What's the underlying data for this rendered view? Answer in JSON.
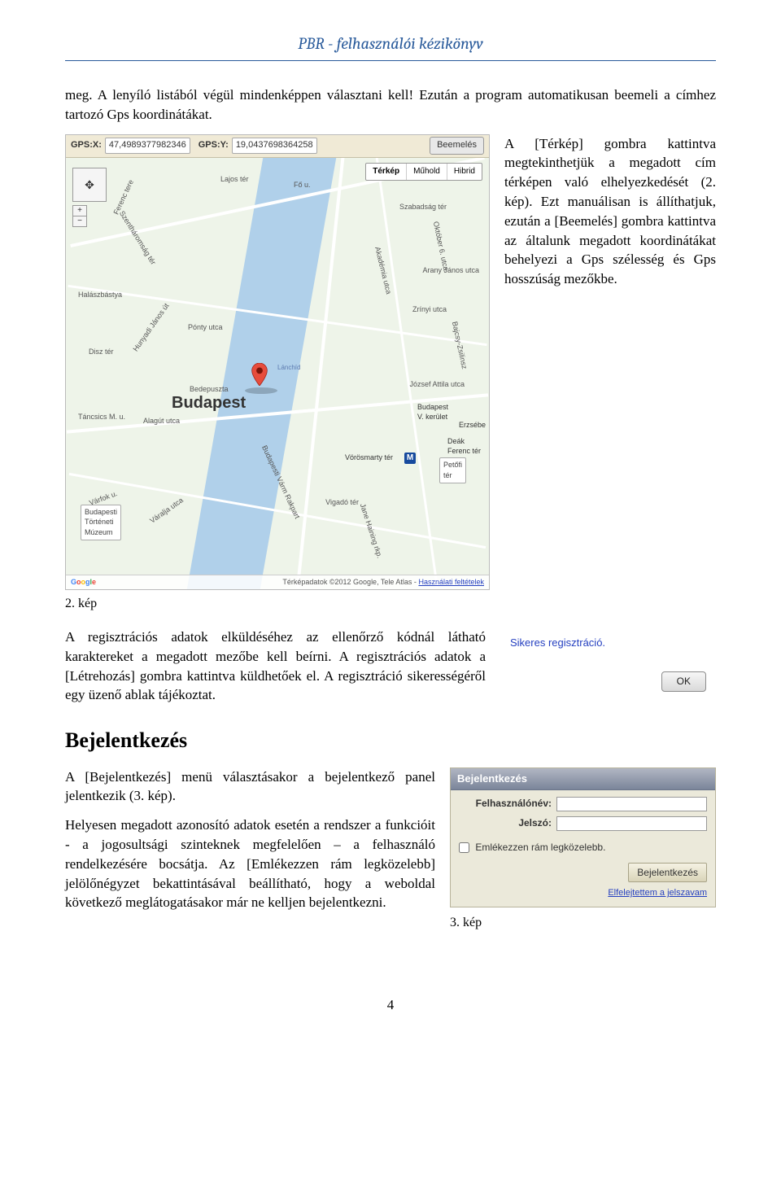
{
  "header": {
    "title": "PBR - felhasználói kézikönyv"
  },
  "intro_p1": "meg. A lenyíló listából végül mindenképpen választani kell! Ezután a program automatikusan beemeli a címhez tartozó Gps koordinátákat.",
  "map": {
    "gpsx_label": "GPS:X:",
    "gpsx_value": "47,4989377982346",
    "gpsy_label": "GPS:Y:",
    "gpsy_value": "19,0437698364258",
    "lift_btn": "Beemelés",
    "types": {
      "terkep": "Térkép",
      "muhold": "Műhold",
      "hibrid": "Hibrid"
    },
    "city": "Budapest",
    "bridge": "Lánchíd",
    "poi_museum": "Budapesti\nTörténeti\nMúzeum",
    "poi_petofi": "Petőfi\ntér",
    "poi_bp5": "Budapest\nV. kerület",
    "poi_vorosmarty": "Vörösmarty tér",
    "poi_deak": "Deák\nFerenc tér",
    "poi_erzsebet": "Erzsébe",
    "streets": {
      "s1": "Lajos tér",
      "s2": "Fő u.",
      "s3": "Szabadság tér",
      "s4": "Arany János utca",
      "s5": "Zrínyi utca",
      "s6": "József Attila utca",
      "s7": "Bajcsy-Zsilinsz",
      "s8": "Október 6. utca",
      "s9": "Akadémia utca",
      "s10": "Hunyadi János út",
      "s11": "Disz tér",
      "s12": "Várfok u.",
      "s13": "Halászbástya",
      "s14": "Pónty utca",
      "s15": "Vigadó tér",
      "s16": "Alagút utca",
      "s17": "Bedepuszta",
      "s18": "Táncsics M. u.",
      "s19": "Ferenc tere",
      "s20": "Jane Haining rkp.",
      "s21": "Váralja utca",
      "s22": "Budapesti Várm Rakpart",
      "s23": "Szentháromság tér"
    },
    "metro": "M",
    "footer_brand": "Google",
    "footer_copy": "Térképadatok ©2012 Google, Tele Atlas -",
    "footer_terms": "Használati feltételek"
  },
  "right_p1": "A [Térkép] gombra kattintva megtekinthetjük a megadott cím térképen való elhelyezkedését (2. kép). Ezt manuálisan is állíthatjuk, ezután a [Beemelés] gombra kattintva az általunk megadott koordinátákat behelyezi a Gps szélesség és Gps hosszúság mezőkbe.",
  "caption_fig2": "2. kép",
  "reg_p": "A regisztrációs adatok elküldéséhez az ellenőrző kódnál látható karaktereket a megadott mezőbe kell beírni. A regisztrációs adatok a [Létrehozás] gombra kattintva küldhetőek el. A regisztráció sikerességéről egy üzenő ablak tájékoztat.",
  "success_dialog": {
    "message": "Sikeres regisztráció.",
    "ok": "OK"
  },
  "section_login": "Bejelentkezés",
  "login_p1": "A [Bejelentkezés] menü választásakor a bejelentkező panel jelentkezik (3. kép).",
  "login_p2": "Helyesen megadott azonosító adatok esetén a rendszer a funkcióit - a jogosultsági szinteknek megfelelően – a felhasználó rendelkezésére bocsátja. Az [Emlékezzen rám legközelebb] jelölőnégyzet bekattintásával beállítható, hogy a weboldal következő meglátogatásakor már ne kelljen bejelentkezni.",
  "login_panel": {
    "title": "Bejelentkezés",
    "user_label": "Felhasználónév:",
    "pass_label": "Jelszó:",
    "remember": "Emlékezzen rám legközelebb.",
    "submit": "Bejelentkezés",
    "forgot": "Elfelejtettem a jelszavam"
  },
  "caption_fig3": "3. kép",
  "page_number": "4"
}
